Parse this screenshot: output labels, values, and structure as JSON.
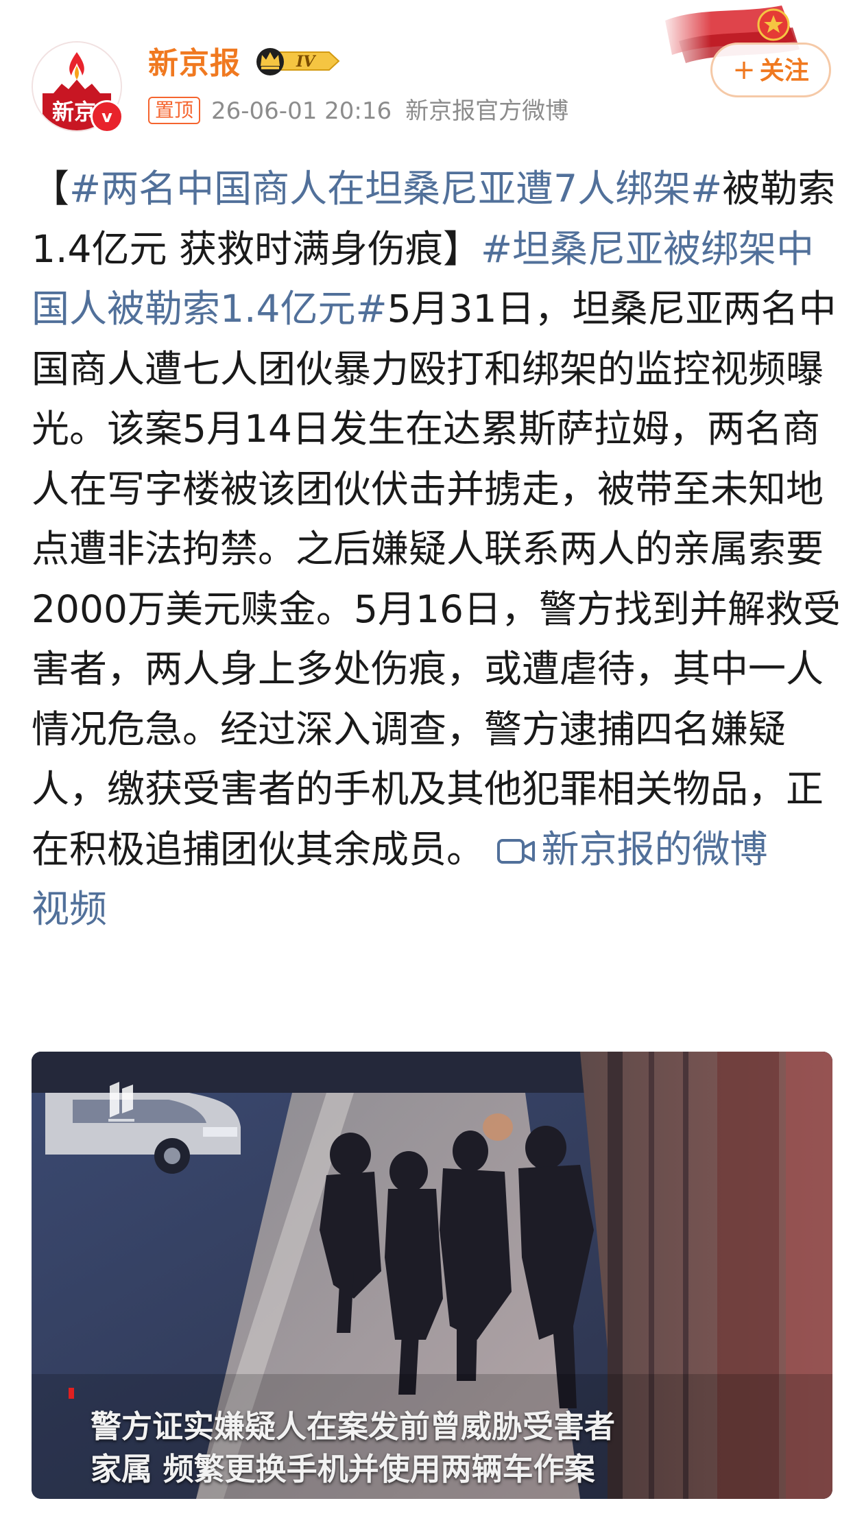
{
  "header": {
    "account_name": "新京报",
    "avatar_text": "新京",
    "verified_mark": "v",
    "vip_level": "IV",
    "pin_label": "置顶",
    "timestamp": "26-06-01 20:16",
    "source": "新京报官方微博",
    "follow_plus": "+",
    "follow_label": "关注"
  },
  "post": {
    "bracket_open": "【",
    "topic_1": "#两名中国商人在坦桑尼亚遭7人绑架#",
    "headline_rest": "被勒索1.4亿元 获救时满身伤痕】",
    "topic_2": "#坦桑尼亚被绑架中国人被勒索1.4亿元#",
    "body": "5月31日，坦桑尼亚两名中国商人遭七人团伙暴力殴打和绑架的监控视频曝光。该案5月14日发生在达累斯萨拉姆，两名商人在写字楼被该团伙伏击并掳走，被带至未知地点遭非法拘禁。之后嫌疑人联系两人的亲属索要2000万美元赎金。5月16日，警方找到并解救受害者，两人身上多处伤痕，或遭虐待，其中一人情况危急。经过深入调查，警方逮捕四名嫌疑人，缴获受害者的手机及其他犯罪相关物品，正在积极追捕团伙其余成员。",
    "video_link_part1": "新京报的微博",
    "video_link_part2": "视频"
  },
  "video": {
    "caption_line1": "警方证实嫌疑人在案发前曾威胁受害者",
    "caption_line2": "家属 频繁更换手机并使用两辆车作案"
  },
  "colors": {
    "accent_orange": "#f07920",
    "link_blue": "#51709a",
    "pin_red": "#f5642e",
    "verified_red": "#e8232c"
  },
  "icons": [
    "vip-crown-icon",
    "plus-icon",
    "video-camera-icon",
    "verified-icon",
    "news-logo-icon"
  ]
}
